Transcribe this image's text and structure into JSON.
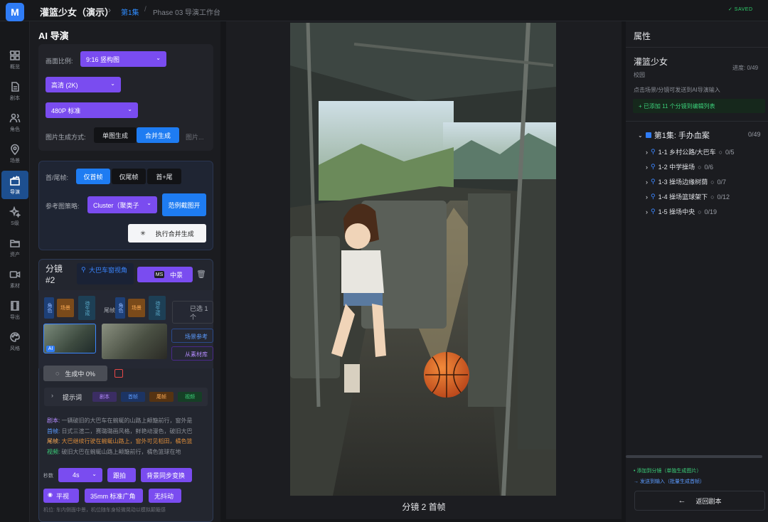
{
  "app": {
    "logo": "M",
    "title": "灌篮少女（演示）",
    "breadcrumb_episode": "第1集",
    "breadcrumb_sep": "/",
    "breadcrumb_phase": "Phase 03  导演工作台",
    "saved": "✓ SAVED"
  },
  "nav": [
    {
      "label": "概览",
      "icon": "grid-icon"
    },
    {
      "label": "剧本",
      "icon": "document-icon"
    },
    {
      "label": "角色",
      "icon": "users-icon"
    },
    {
      "label": "场景",
      "icon": "map-pin-icon"
    },
    {
      "label": "导演",
      "icon": "clapperboard-icon"
    },
    {
      "label": "S级",
      "icon": "sparkle-icon"
    },
    {
      "label": "资产",
      "icon": "folder-icon"
    },
    {
      "label": "素材",
      "icon": "camera-icon"
    },
    {
      "label": "导出",
      "icon": "film-icon"
    },
    {
      "label": "风格",
      "icon": "palette-icon"
    }
  ],
  "left": {
    "title": "AI 导演",
    "ratio_label": "画面比例:",
    "ratio_value": "9:16 竖构图",
    "quality_value": "高清 (2K)",
    "res_value": "480P 标准",
    "gen_mode_label": "图片生成方式:",
    "gen_single": "单图生成",
    "gen_merge": "合并生成",
    "gen_more": "图片...",
    "frame_label": "首/尾帧:",
    "frame_first": "仅首帧",
    "frame_last": "仅尾帧",
    "frame_both": "首+尾",
    "ref_label": "参考图策略:",
    "ref_value": "Cluster（聚类子",
    "ref_btn": "范例截图开",
    "exec_btn": "执行合并生成",
    "shot_title": "分镜 #2",
    "shot_scene": "大巴车窗视角",
    "shot_mid_tag": "MS",
    "shot_mid_label": "中景",
    "frame_col1": "首帧",
    "frame_col2": "尾帧",
    "tile_a": "角色",
    "tile_b": "场景",
    "tile_c": "待生成",
    "selected_label": "已选 1 个",
    "scene_ref_btn": "场景参考",
    "from_lib_btn": "从素材库",
    "thumb_badge": "AI",
    "generating": "生成中 0%",
    "prompt_toggle": "提示词",
    "tag_script": "剧本",
    "tag_image": "首帧",
    "tag_tail": "尾帧",
    "tag_video": "视频",
    "prompt_lines": [
      {
        "label": "剧本:",
        "text": "一辆破旧的大巴车在蜿蜒的山路上颠簸前行，窗外是"
      },
      {
        "label": "首帧:",
        "text": "日式三渲二，赛璐璐画风格，鲜艳动漫色，破旧大巴"
      },
      {
        "label": "尾帧:",
        "text": "大巴继续行驶在蜿蜒山路上，窗外可见稻田，橘色篮"
      },
      {
        "label": "视频:",
        "text": "破旧大巴在蜿蜒山路上颠簸前行，橘色篮球在地"
      }
    ],
    "duration_label": "秒数",
    "duration_value": "4s",
    "shot_type": "跟拍",
    "transition": "背景同步变换",
    "angle": "平视",
    "lens": "35mm 标准广角",
    "movement": "无抖动",
    "motion_label": "机位:",
    "motion_text": "车内侧面中景，机位随车身轻微晃动以模拟颠簸感"
  },
  "center": {
    "caption": "分镜 2 首帧"
  },
  "right": {
    "header": "属性",
    "project": "灌篮少女",
    "project_sub": "校园",
    "progress": "进度: 0/49",
    "hint": "点击场景/分镜可发送到AI导演输入",
    "added_note": "+ 已添加 11 个分镜到编辑列表",
    "episode": "第1集: 手办血案",
    "episode_count": "0/49",
    "scenes": [
      {
        "name": "1-1 乡村公路/大巴车",
        "count": "0/5"
      },
      {
        "name": "1-2 中学操场",
        "count": "0/6"
      },
      {
        "name": "1-3 操场边缘树荫",
        "count": "0/7"
      },
      {
        "name": "1-4 操场篮球架下",
        "count": "0/12"
      },
      {
        "name": "1-5 操场中央",
        "count": "0/19"
      }
    ],
    "legend1": "• 添加到分镜（单独生成图片）",
    "legend2": "→ 发送到输入（批量生成首帧）",
    "back_btn": "返回剧本"
  }
}
